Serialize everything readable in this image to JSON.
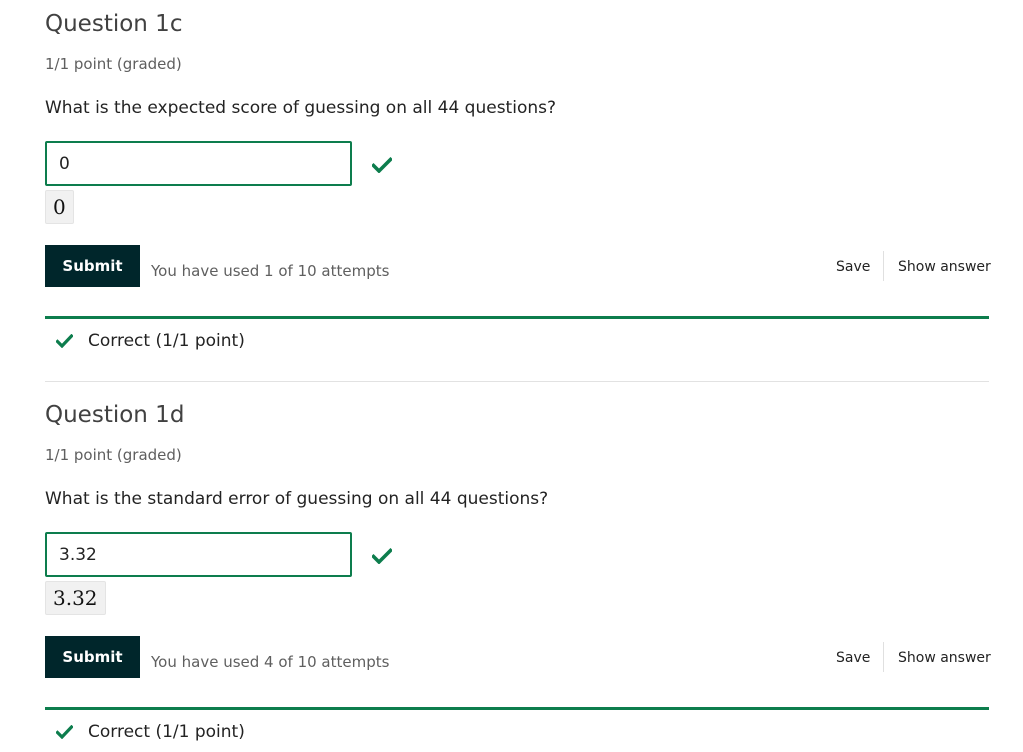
{
  "questions": [
    {
      "title": "Question 1c",
      "points": "1/1 point (graded)",
      "prompt": "What is the expected score of guessing on all 44 questions?",
      "answer_value": "0",
      "preview": "0",
      "submit_label": "Submit",
      "attempts": "You have used 1 of 10 attempts",
      "save_label": "Save",
      "show_answer_label": "Show answer",
      "result": "Correct (1/1 point)"
    },
    {
      "title": "Question 1d",
      "points": "1/1 point (graded)",
      "prompt": "What is the standard error of guessing on all 44 questions?",
      "answer_value": "3.32",
      "preview": "3.32",
      "submit_label": "Submit",
      "attempts": "You have used 4 of 10 attempts",
      "save_label": "Save",
      "show_answer_label": "Show answer",
      "result": "Correct (1/1 point)"
    }
  ],
  "colors": {
    "correct": "#0d7d4d",
    "submit_bg": "#00262b"
  },
  "icons": {
    "answer_status": "check-icon",
    "result_status": "check-icon"
  }
}
